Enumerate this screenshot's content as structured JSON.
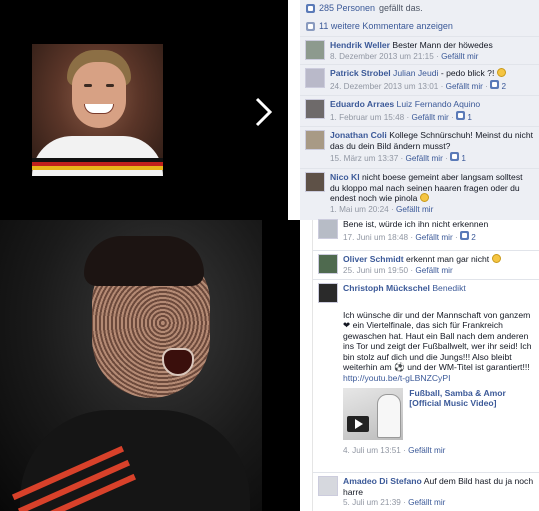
{
  "photos": {
    "top_alt": "",
    "next_icon": "chevron-right-icon"
  },
  "panel": {
    "likes_count": "285 Personen",
    "likes_suffix": "gefällt das.",
    "more_comments": "11 weitere Kommentare anzeigen"
  },
  "comments_top": [
    {
      "author": "Hendrik Weller",
      "text": "Bester Mann der höwedes",
      "time": "8. Dezember 2013 um 21:15",
      "like_label": "Gefällt mir",
      "like_count": ""
    },
    {
      "author": "Patrick Strobel",
      "tag": "Julian Jeudi",
      "text": "- pedo blick ?!",
      "time": "24. Dezember 2013 um 13:01",
      "like_label": "Gefällt mir",
      "like_count": "2"
    },
    {
      "author": "Eduardo Arraes",
      "tag": "Luiz Fernando Aquino",
      "text": "",
      "time": "1. Februar um 15:48",
      "like_label": "Gefällt mir",
      "like_count": "1"
    },
    {
      "author": "Jonathan Coli",
      "text": "Kollege Schnürschuh! Meinst du nicht das du dein Bild ändern musst?",
      "time": "15. März um 13:37",
      "like_label": "Gefällt mir",
      "like_count": "1"
    },
    {
      "author": "Nico Kl",
      "text": "nicht boese gemeint aber langsam solltest du kloppo mal nach seinen haaren fragen oder du endest noch wie pinola",
      "time": "1. Mai um 20:24",
      "like_label": "Gefällt mir",
      "like_count": ""
    }
  ],
  "comments_bottom": [
    {
      "text": "Bene ist, würde ich ihn nicht erkennen",
      "time": "17. Juni um 18:48",
      "like_label": "Gefällt mir",
      "like_count": "2"
    },
    {
      "author": "Oliver Schmidt",
      "text": "erkennt man gar nicht",
      "time": "25. Juni um 19:50",
      "like_label": "Gefällt mir"
    },
    {
      "author": "Christoph Mückschel",
      "tag": "Benedikt",
      "text": "Ich wünsche dir und der Mannschaft von ganzem ❤ ein Viertelfinale, das sich für Frankreich gewaschen hat. Haut ein Ball nach dem anderen ins Tor und zeigt der Fußballwelt, wer ihr seid! Ich bin stolz auf dich und die Jungs!!! Also bleibt weiterhin am ⚽ und der WM-Titel ist garantiert!!!",
      "link": "http://youtu.be/t-gLBNZCyPI",
      "video_title": "Fußball, Samba & Amor [Official Music Video]",
      "time": "4. Juli um 13:51",
      "like_label": "Gefällt mir"
    },
    {
      "author": "Amadeo Di Stefano",
      "text": "Auf dem Bild hast du ja noch harre",
      "time": "5. Juli um 21:39",
      "like_label": "Gefällt mir"
    }
  ]
}
